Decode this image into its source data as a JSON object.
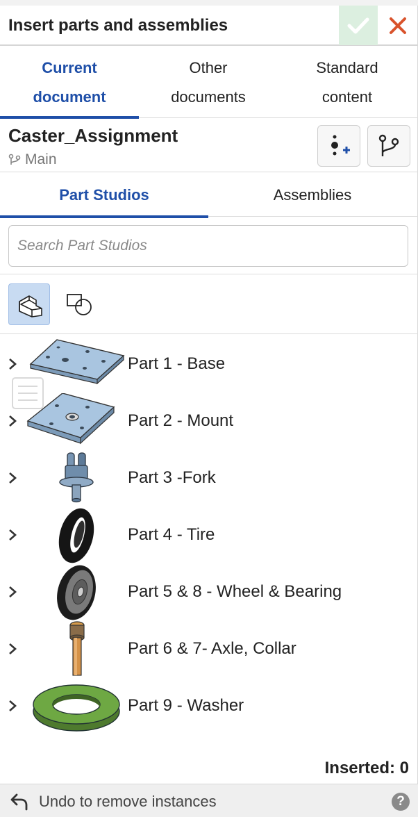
{
  "dialog": {
    "title": "Insert parts and assemblies",
    "colors": {
      "accent": "#1f4fa8",
      "confirm_bg": "#dcefe0",
      "confirm_check": "#ffffff",
      "close_x": "#d9532c",
      "filter_active": "#c8dbf2"
    }
  },
  "source_tabs": [
    {
      "line1": "Current",
      "line2": "document",
      "active": true
    },
    {
      "line1": "Other",
      "line2": "documents",
      "active": false
    },
    {
      "line1": "Standard",
      "line2": "content",
      "active": false
    }
  ],
  "document": {
    "name": "Caster_Assignment",
    "branch": "Main"
  },
  "sub_tabs": [
    {
      "label": "Part Studios",
      "active": true
    },
    {
      "label": "Assemblies",
      "active": false
    }
  ],
  "search": {
    "placeholder": "Search Part Studios",
    "value": ""
  },
  "filters": [
    {
      "icon": "part-studio-filter-icon",
      "active": true
    },
    {
      "icon": "sketch-filter-icon",
      "active": false
    }
  ],
  "items": [
    {
      "label": "Part 1 - Base",
      "icon": "base-plate-thumbnail"
    },
    {
      "label": "Part 2 - Mount",
      "icon": "mount-plate-thumbnail"
    },
    {
      "label": "Part 3 -Fork",
      "icon": "fork-thumbnail"
    },
    {
      "label": "Part 4 - Tire",
      "icon": "tire-thumbnail"
    },
    {
      "label": "Part 5 & 8 - Wheel & Bearing",
      "icon": "wheel-thumbnail"
    },
    {
      "label": "Part 6 & 7- Axle, Collar",
      "icon": "axle-thumbnail"
    },
    {
      "label": "Part 9 - Washer",
      "icon": "washer-thumbnail"
    }
  ],
  "status": {
    "inserted": "Inserted: 0"
  },
  "footer": {
    "undo_text": "Undo to remove instances",
    "help": "?"
  }
}
